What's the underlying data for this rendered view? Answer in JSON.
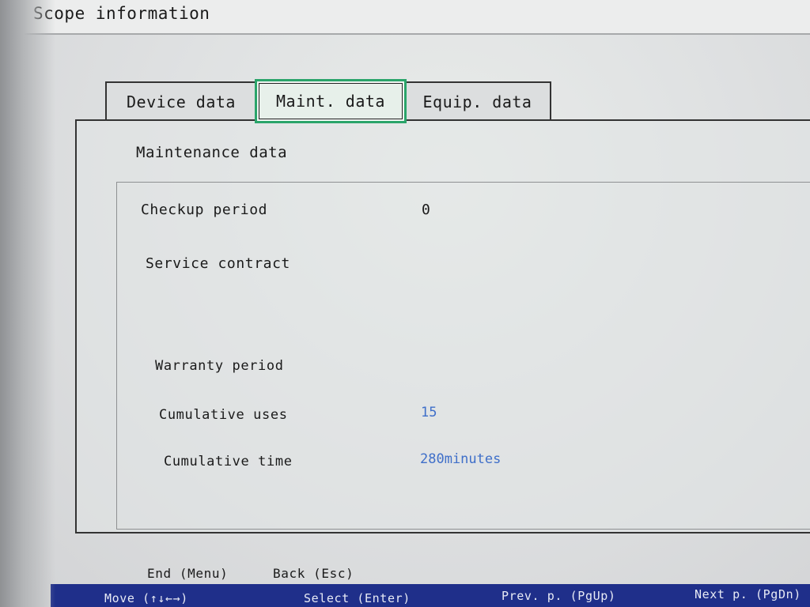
{
  "window": {
    "title": "Scope information"
  },
  "tabs": [
    {
      "label": "Device data",
      "active": false
    },
    {
      "label": "Maint. data",
      "active": true
    },
    {
      "label": "Equip. data",
      "active": false
    }
  ],
  "section": {
    "title": "Maintenance data"
  },
  "fields": {
    "checkup_period": {
      "label": "Checkup period",
      "value": "0"
    },
    "service_contract": {
      "label": "Service contract",
      "value": ""
    },
    "warranty_period": {
      "label": "Warranty period",
      "value": ""
    },
    "cumulative_uses": {
      "label": "Cumulative uses",
      "value": "15"
    },
    "cumulative_time": {
      "label": "Cumulative time",
      "value": "280minutes"
    }
  },
  "footer": {
    "end_label": "End (Menu)",
    "back_label": "Back (Esc)"
  },
  "status_bar": {
    "move_label": "Move (↑↓←→)",
    "select_label": "Select (Enter)",
    "prev_label": "Prev. p. (PgUp)",
    "next_label": "Next p. (PgDn)"
  },
  "colors": {
    "active_tab_border": "#2aa46a",
    "value_text": "#3f6fc9",
    "status_bar_bg": "#1f2f8a"
  }
}
